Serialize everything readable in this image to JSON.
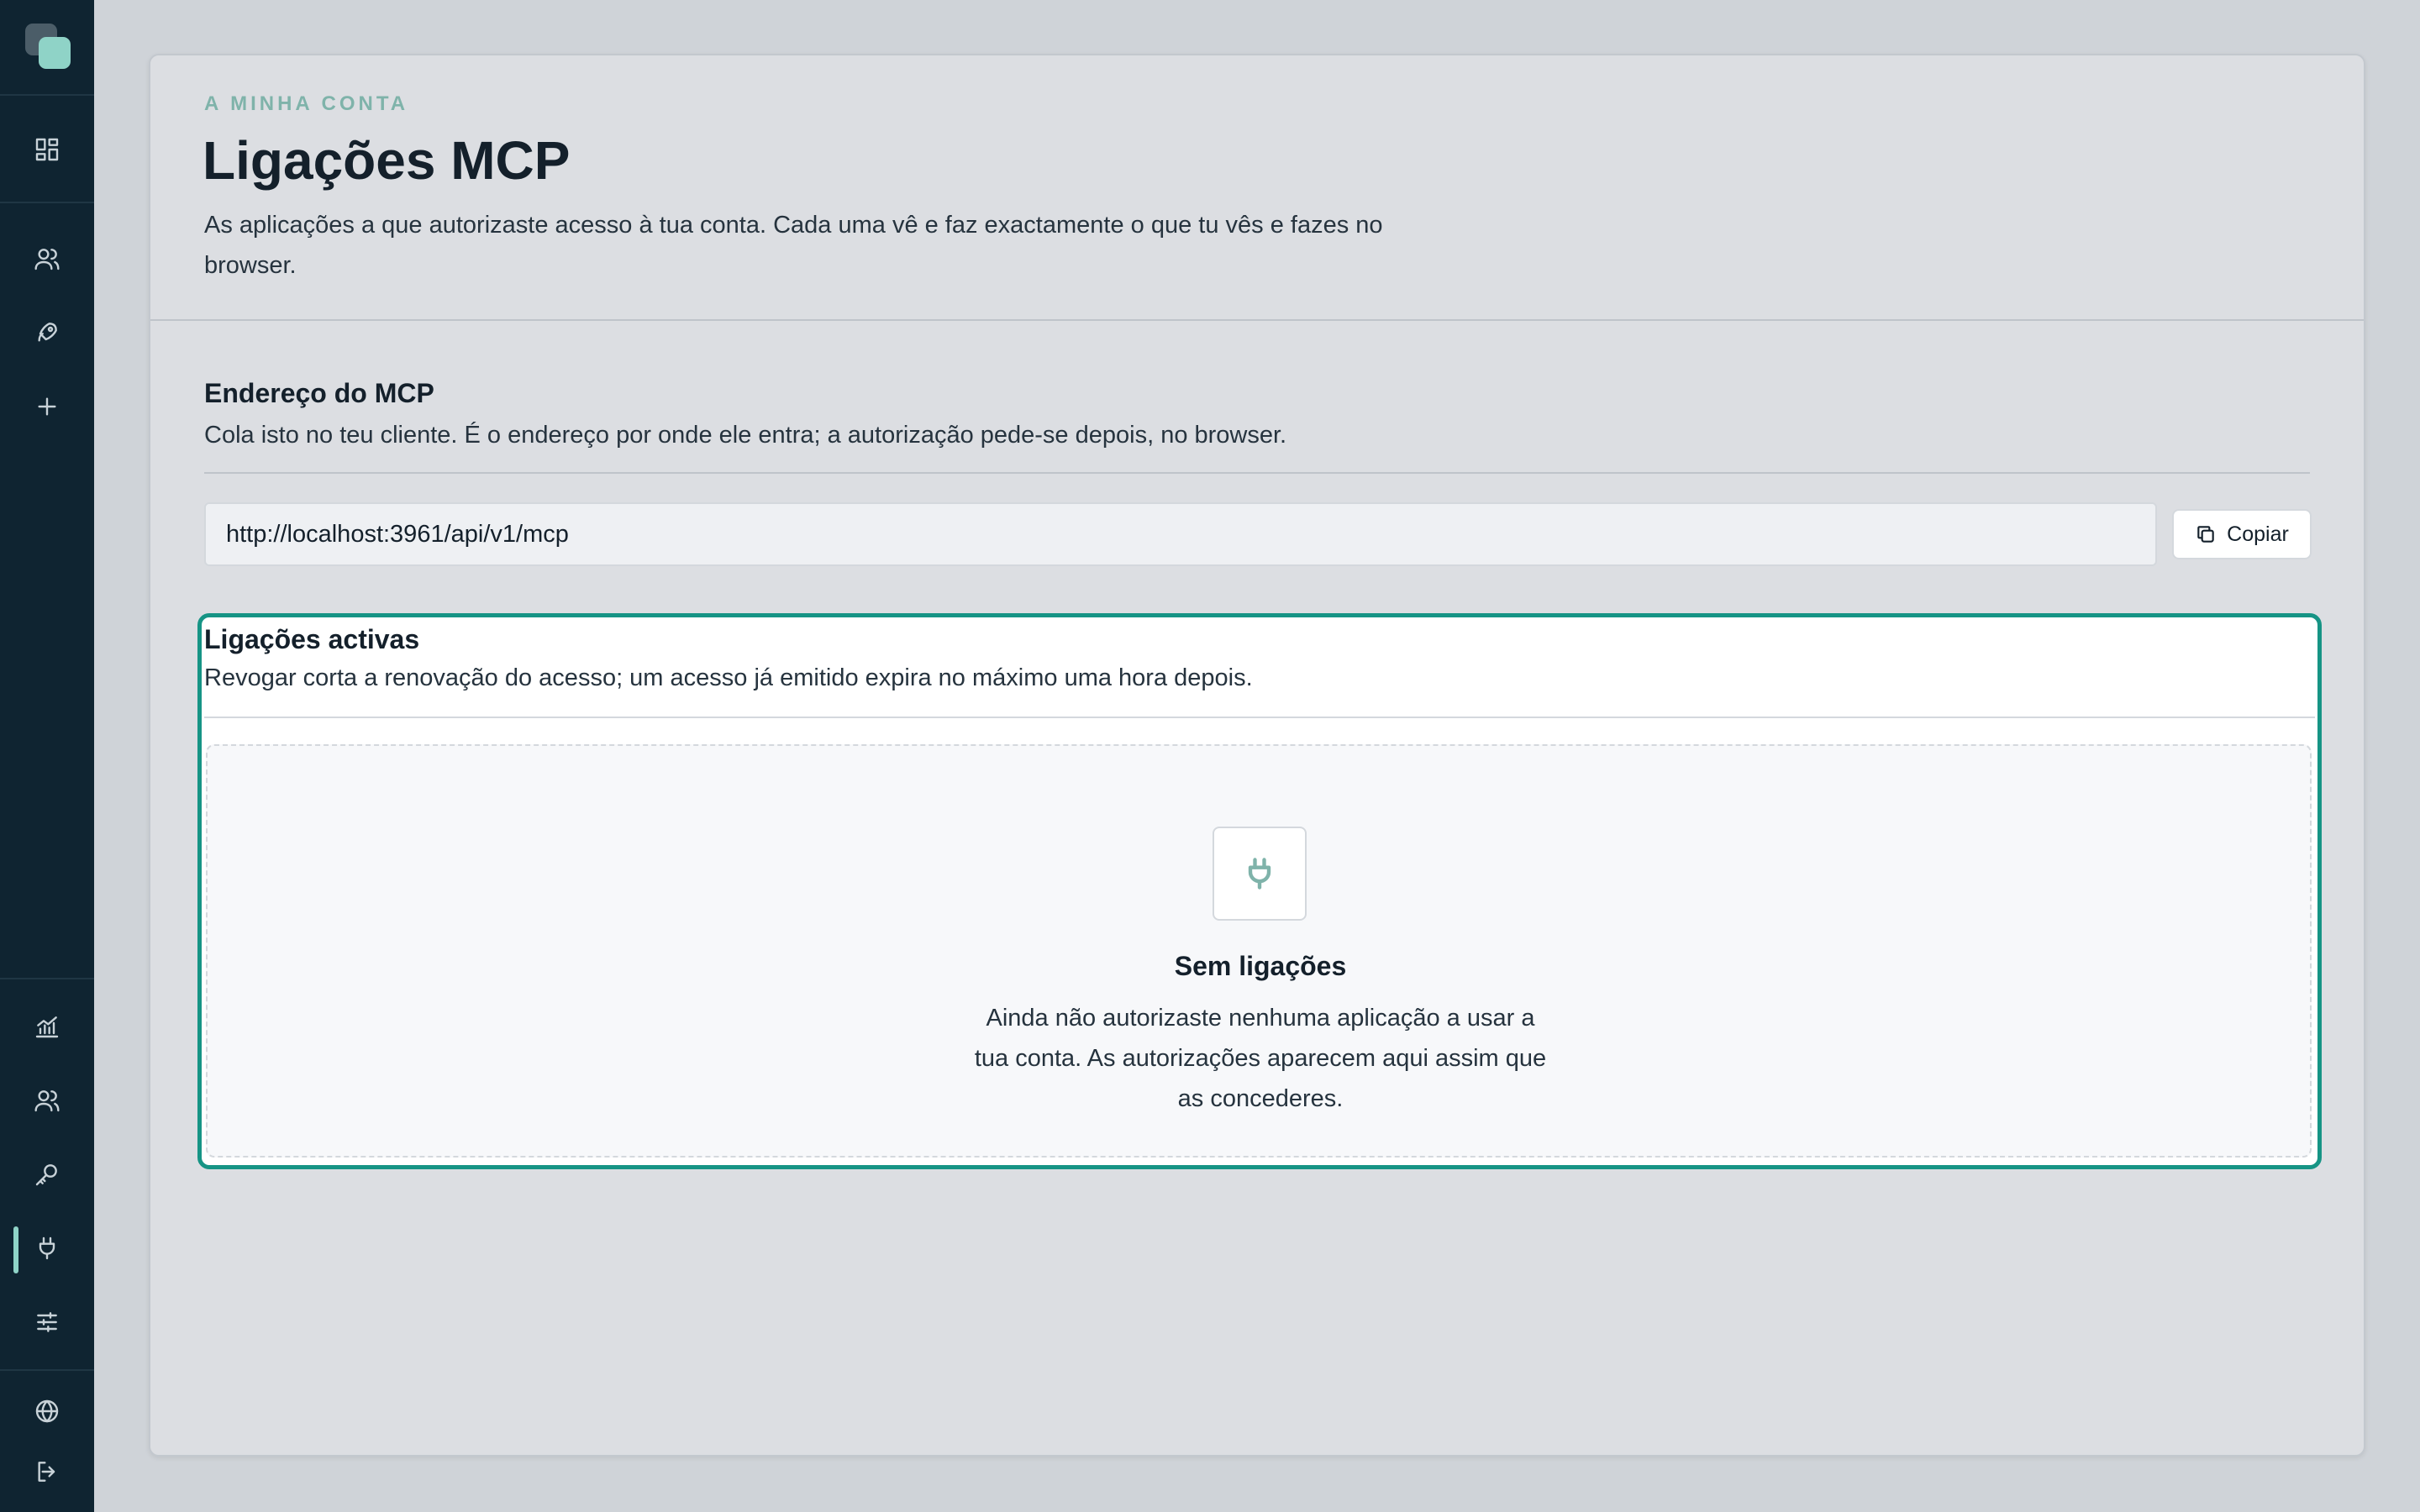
{
  "sidebar": {
    "logo_icon": "app-logo",
    "nav_top": [
      {
        "icon": "dashboard-icon"
      },
      {
        "icon": "users-icon"
      },
      {
        "icon": "rocket-icon"
      },
      {
        "icon": "plus-icon"
      }
    ],
    "nav_bottom": [
      {
        "icon": "chart-icon"
      },
      {
        "icon": "users-icon"
      },
      {
        "icon": "key-icon"
      },
      {
        "icon": "plug-icon",
        "active": true
      },
      {
        "icon": "sliders-icon"
      }
    ],
    "footer": [
      {
        "icon": "globe-icon"
      },
      {
        "icon": "logout-icon"
      }
    ],
    "accent_color": "#8fd3c7",
    "background_color": "#0f2431"
  },
  "header": {
    "eyebrow": "A MINHA CONTA",
    "title": "Ligações MCP",
    "description": "As aplicações a que autorizaste acesso à tua conta. Cada uma vê e faz exactamente o que tu vês e fazes no browser."
  },
  "mcp_address": {
    "title": "Endereço do MCP",
    "description": "Cola isto no teu cliente. É o endereço por onde ele entra; a autorização pede-se depois, no browser.",
    "url_value": "http://localhost:3961/api/v1/mcp",
    "copy_label": "Copiar"
  },
  "active_connections": {
    "title": "Ligações activas",
    "description": "Revogar corta a renovação do acesso; um acesso já emitido expira no máximo uma hora depois.",
    "empty_title": "Sem ligações",
    "empty_description": "Ainda não autorizaste nenhuma aplicação a usar a tua conta. As autorizações aparecem aqui assim que as concederes.",
    "highlight_color": "#169485"
  }
}
